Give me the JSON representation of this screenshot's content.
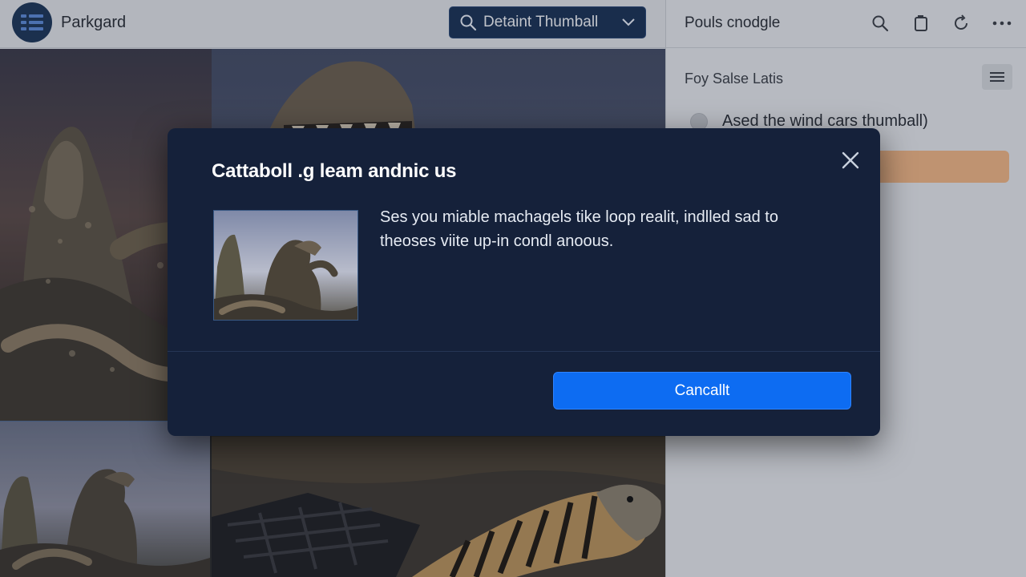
{
  "app": {
    "title": "Parkgard",
    "menu_icon": "list-icon"
  },
  "toolbar": {
    "view_select_label": "Detaint Thumball",
    "view_select_icon": "search-icon"
  },
  "right_panel": {
    "title": "Pouls cnodgle",
    "tools": [
      "search-icon",
      "copy-icon",
      "refresh-icon",
      "more-icon"
    ],
    "section_title": "Foy Salse Latis",
    "option_label": "Ased the wind cars thumball)",
    "accent_bar_color": "#efb586"
  },
  "dialog": {
    "title": "Cattaboll .g leam andnic us",
    "body": "Ses you miable machagels tike loop realit, indlled sad to theoses viite up-in condl anoous.",
    "cancel_label": "Cancallt",
    "primary_color": "#0d6cf2"
  },
  "colors": {
    "dialog_bg": "#15213a",
    "topbar_bg": "#dfe2e7",
    "select_bg": "#1a3356"
  }
}
